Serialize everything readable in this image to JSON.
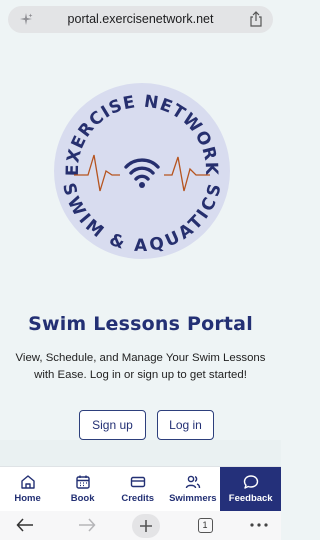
{
  "browser": {
    "url": "portal.exercisenetwork.net",
    "tab_count": "1"
  },
  "logo": {
    "top_text": "EXERCISE NETWORK",
    "bottom_text": "SWIM & AQUATICS",
    "colors": {
      "circle": "#d8dcef",
      "text": "#262f6e",
      "line": "#b6541f"
    }
  },
  "hero": {
    "title": "Swim Lessons Portal",
    "subtitle": "View, Schedule, and Manage Your Swim Lessons with Ease. Log in or sign up to get started!"
  },
  "actions": {
    "signup": "Sign up",
    "login": "Log in"
  },
  "nav": {
    "items": [
      {
        "label": "Home",
        "icon": "home-icon"
      },
      {
        "label": "Book",
        "icon": "calendar-icon"
      },
      {
        "label": "Credits",
        "icon": "credit-card-icon"
      },
      {
        "label": "Swimmers",
        "icon": "users-icon"
      },
      {
        "label": "Feedback",
        "icon": "chat-bubble-icon",
        "active": true
      }
    ]
  },
  "colors": {
    "primary": "#233074",
    "background": "#eef4f5"
  }
}
